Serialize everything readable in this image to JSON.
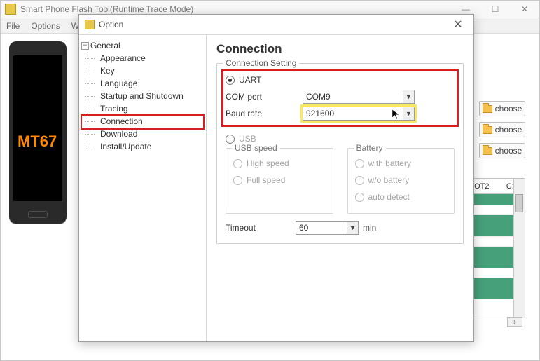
{
  "main_window": {
    "title": "Smart Phone Flash Tool(Runtime Trace Mode)",
    "menu": [
      "File",
      "Options",
      "Wi"
    ],
    "device_screen_text": "MT67",
    "choose_label": "choose",
    "table_headers": [
      "OT2",
      "C:\\"
    ]
  },
  "dialog": {
    "title": "Option",
    "tree": {
      "root": "General",
      "children": [
        "Appearance",
        "Key",
        "Language",
        "Startup and Shutdown",
        "Tracing",
        "Connection",
        "Download",
        "Install/Update"
      ],
      "selected_index": 5
    },
    "panel": {
      "heading": "Connection",
      "legend": "Connection Setting",
      "uart_label": "UART",
      "com_port_label": "COM port",
      "com_port_value": "COM9",
      "baud_label": "Baud rate",
      "baud_value": "921600",
      "usb_label": "USB",
      "usb_speed_legend": "USB speed",
      "usb_speed_options": [
        "High speed",
        "Full speed"
      ],
      "battery_legend": "Battery",
      "battery_options": [
        "with battery",
        "w/o battery",
        "auto detect"
      ],
      "timeout_label": "Timeout",
      "timeout_value": "60",
      "timeout_unit": "min"
    }
  }
}
